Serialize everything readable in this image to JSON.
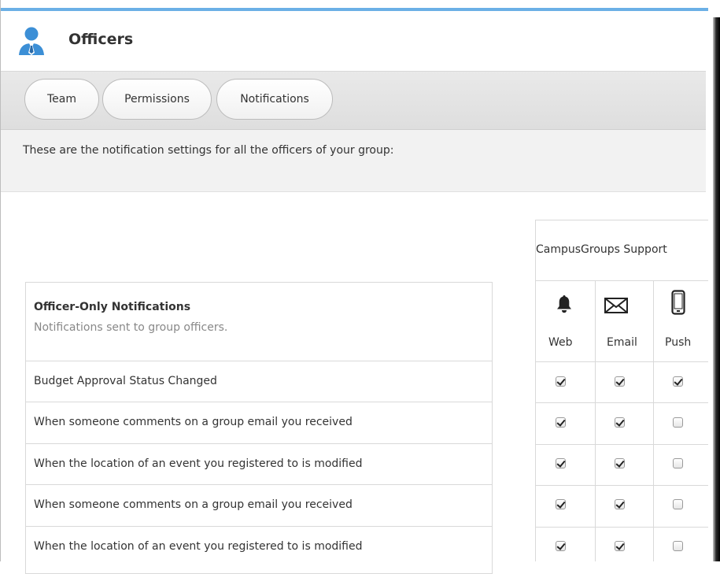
{
  "header": {
    "title": "Officers"
  },
  "tabs": [
    {
      "label": "Team"
    },
    {
      "label": "Permissions"
    },
    {
      "label": "Notifications"
    }
  ],
  "intro": "These are the notification settings for all the officers of your group:",
  "section": {
    "title": "Officer-Only Notifications",
    "subtitle": "Notifications sent to group officers."
  },
  "support_column": {
    "title": "CampusGroups Support",
    "columns": [
      {
        "label": "Web",
        "icon": "bell-icon"
      },
      {
        "label": "Email",
        "icon": "envelope-icon"
      },
      {
        "label": "Push",
        "icon": "phone-icon"
      }
    ]
  },
  "rows": [
    {
      "label": "Budget Approval Status Changed",
      "web": true,
      "email": true,
      "push": true
    },
    {
      "label": "When someone comments on a group email you received",
      "web": true,
      "email": true,
      "push": false
    },
    {
      "label": "When the location of an event you registered to is modified",
      "web": true,
      "email": true,
      "push": false
    },
    {
      "label": "When someone comments on a group email you received",
      "web": true,
      "email": true,
      "push": false
    },
    {
      "label": "When the location of an event you registered to is modified",
      "web": true,
      "email": true,
      "push": false
    }
  ],
  "colors": {
    "accent": "#6bb0e6",
    "toolbar": "#e4e4e4",
    "intro_bg": "#f2f2f2"
  }
}
